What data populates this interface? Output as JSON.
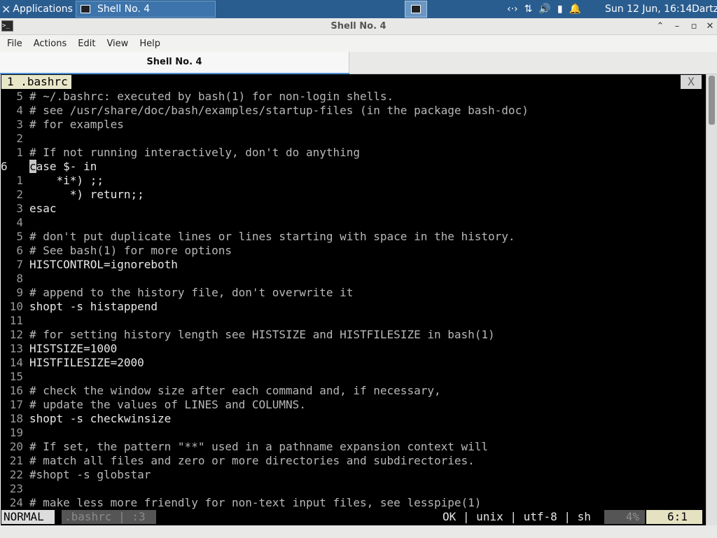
{
  "panel": {
    "applications_label": "Applications",
    "task_label": "Shell No. 4",
    "tray_network": "‹·›",
    "tray_updown": "⇅",
    "tray_volume": "🔊",
    "tray_battery": "▮",
    "tray_bell": "🔔",
    "clock": "Sun 12 Jun, 16:14",
    "user": "Dartz"
  },
  "window": {
    "title": "Shell No. 4",
    "btn_up": "⌃",
    "btn_min": "–",
    "btn_max": "▫",
    "btn_close": "✕"
  },
  "menu": {
    "file": "File",
    "actions": "Actions",
    "edit": "Edit",
    "view": "View",
    "help": "Help"
  },
  "tab": {
    "label": "Shell No. 4"
  },
  "vim": {
    "tabline_label": "1 .bashrc",
    "tabline_close": "X",
    "lines": [
      {
        "num": "5",
        "text": "# ~/.bashrc: executed by bash(1) for non-login shells.",
        "cls": "cmt"
      },
      {
        "num": "4",
        "text": "# see /usr/share/doc/bash/examples/startup-files (in the package bash-doc)",
        "cls": "cmt"
      },
      {
        "num": "3",
        "text": "# for examples",
        "cls": "cmt"
      },
      {
        "num": "2",
        "text": "",
        "cls": ""
      },
      {
        "num": "1",
        "text": "# If not running interactively, don't do anything",
        "cls": "cmt"
      },
      {
        "num": "6",
        "text": "case $- in",
        "cls": "kw",
        "current": true
      },
      {
        "num": "1",
        "text": "    *i*) ;;",
        "cls": "kw"
      },
      {
        "num": "2",
        "text": "      *) return;;",
        "cls": "kw"
      },
      {
        "num": "3",
        "text": "esac",
        "cls": "kw"
      },
      {
        "num": "4",
        "text": "",
        "cls": ""
      },
      {
        "num": "5",
        "text": "# don't put duplicate lines or lines starting with space in the history.",
        "cls": "cmt"
      },
      {
        "num": "6",
        "text": "# See bash(1) for more options",
        "cls": "cmt"
      },
      {
        "num": "7",
        "text": "HISTCONTROL=ignoreboth",
        "cls": "kw"
      },
      {
        "num": "8",
        "text": "",
        "cls": ""
      },
      {
        "num": "9",
        "text": "# append to the history file, don't overwrite it",
        "cls": "cmt"
      },
      {
        "num": "10",
        "text": "shopt -s histappend",
        "cls": "kw"
      },
      {
        "num": "11",
        "text": "",
        "cls": ""
      },
      {
        "num": "12",
        "text": "# for setting history length see HISTSIZE and HISTFILESIZE in bash(1)",
        "cls": "cmt"
      },
      {
        "num": "13",
        "text": "HISTSIZE=1000",
        "cls": "kw"
      },
      {
        "num": "14",
        "text": "HISTFILESIZE=2000",
        "cls": "kw"
      },
      {
        "num": "15",
        "text": "",
        "cls": ""
      },
      {
        "num": "16",
        "text": "# check the window size after each command and, if necessary,",
        "cls": "cmt"
      },
      {
        "num": "17",
        "text": "# update the values of LINES and COLUMNS.",
        "cls": "cmt"
      },
      {
        "num": "18",
        "text": "shopt -s checkwinsize",
        "cls": "kw"
      },
      {
        "num": "19",
        "text": "",
        "cls": ""
      },
      {
        "num": "20",
        "text": "# If set, the pattern \"**\" used in a pathname expansion context will",
        "cls": "cmt"
      },
      {
        "num": "21",
        "text": "# match all files and zero or more directories and subdirectories.",
        "cls": "cmt"
      },
      {
        "num": "22",
        "text": "#shopt -s globstar",
        "cls": "cmt"
      },
      {
        "num": "23",
        "text": "",
        "cls": ""
      },
      {
        "num": "24",
        "text": "# make less more friendly for non-text input files, see lesspipe(1)",
        "cls": "cmt"
      }
    ],
    "status": {
      "mode": "NORMAL",
      "file": ".bashrc | :3",
      "encoding": "OK | unix | utf-8 | sh",
      "percent": "4%",
      "position": "6:1"
    }
  }
}
